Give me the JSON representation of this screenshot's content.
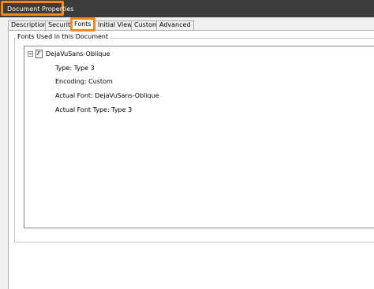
{
  "window": {
    "title": "Document Properties"
  },
  "tabs": [
    {
      "label": "Description"
    },
    {
      "label": "Security"
    },
    {
      "label": "Fonts",
      "active": true
    },
    {
      "label": "Initial View"
    },
    {
      "label": "Custom"
    },
    {
      "label": "Advanced"
    }
  ],
  "fonts_panel": {
    "group_label": "Fonts Used in this Document",
    "font_name": "DejaVuSans-Oblique",
    "font_icon_glyph": "F",
    "properties": [
      "Type: Type 3",
      "Encoding: Custom",
      "Actual Font: DejaVuSans-Oblique",
      "Actual Font Type: Type 3"
    ]
  },
  "colors": {
    "highlight": "#f08a1c",
    "titlebar": "#3c3c3c"
  }
}
